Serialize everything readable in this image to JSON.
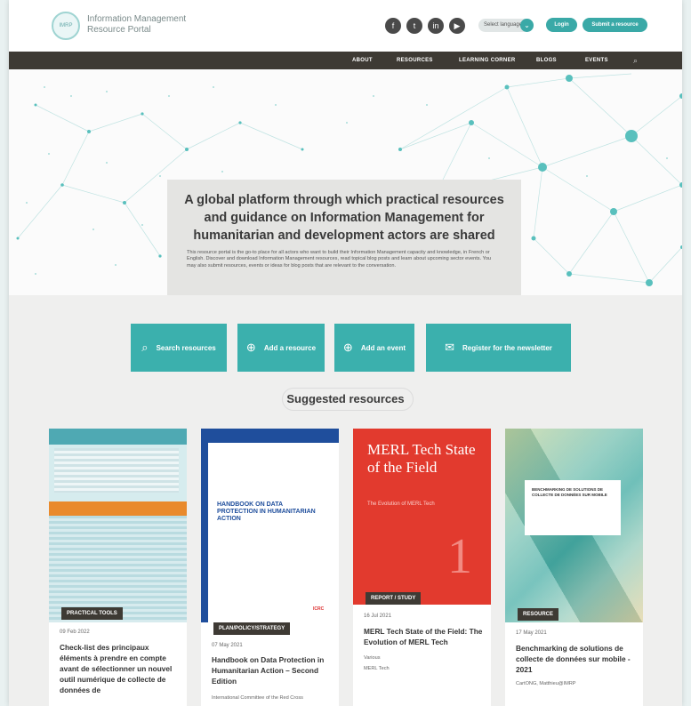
{
  "header": {
    "portal_name_line1": "Information Management",
    "portal_name_line2": "Resource Portal",
    "logo_text": "IMRP",
    "social_icons": [
      "facebook-icon",
      "twitter-icon",
      "linkedin-icon",
      "youtube-icon"
    ],
    "language": "Select language",
    "login_label": "Login",
    "submit_label": "Submit a resource"
  },
  "nav": {
    "items": [
      "ABOUT",
      "RESOURCES",
      "LEARNING CORNER",
      "BLOGS",
      "EVENTS"
    ],
    "search_icon": "search-icon"
  },
  "hero": {
    "title": "A global platform through which practical resources and guidance on Information Management for humanitarian and development actors are shared",
    "body": "This resource portal is the go-to place for all actors who want to build their Information Management capacity and knowledge, in French or English. Discover and download Information Management resources, read topical blog posts and learn about upcoming sector events. You may also submit resources, events or ideas for blog posts that are relevant to the conversation."
  },
  "actions": [
    {
      "label": "Search resources",
      "icon": "search-icon"
    },
    {
      "label": "Add a resource",
      "icon": "plus-circle-icon"
    },
    {
      "label": "Add an event",
      "icon": "plus-circle-icon"
    },
    {
      "label": "Register for the newsletter",
      "icon": "envelope-icon"
    }
  ],
  "suggested_title": "Suggested resources",
  "cards": [
    {
      "tag": "PRACTICAL TOOLS",
      "date": "09 Feb 2022",
      "title": "Check-list des principaux éléments à prendre en compte avant de sélectionner un nouvel outil numérique de collecte de données de",
      "meta": ""
    },
    {
      "tag": "PLAN/POLICY/STRATEGY",
      "date": "07 May 2021",
      "title": "Handbook on Data Protection in Humanitarian Action – Second Edition",
      "meta": "International Committee of the Red Cross",
      "cover_title": "HANDBOOK ON DATA PROTECTION IN HUMANITARIAN ACTION",
      "cover_brand": "ICRC"
    },
    {
      "tag": "REPORT / STUDY",
      "date": "16 Jul 2021",
      "title": "MERL Tech State of the Field: The Evolution of MERL Tech",
      "meta": "Various",
      "meta2": "MERL Tech",
      "cover_title": "MERL Tech State of the Field",
      "cover_sub": "The Evolution of MERL Tech",
      "cover_num": "1"
    },
    {
      "tag": "RESOURCE",
      "date": "17 May 2021",
      "title": "Benchmarking de solutions de collecte de données sur mobile - 2021",
      "meta": "CartONG, Matthieu@IMRP",
      "cover_title": "BENCHMARKING DE SOLUTIONS DE COLLECTE DE DONNÉES SUR MOBILE"
    }
  ],
  "colors": {
    "accent": "#3bb0ad",
    "dark": "#3e3a34",
    "merl_red": "#e23a2e",
    "icrc_blue": "#1f4e9c"
  }
}
